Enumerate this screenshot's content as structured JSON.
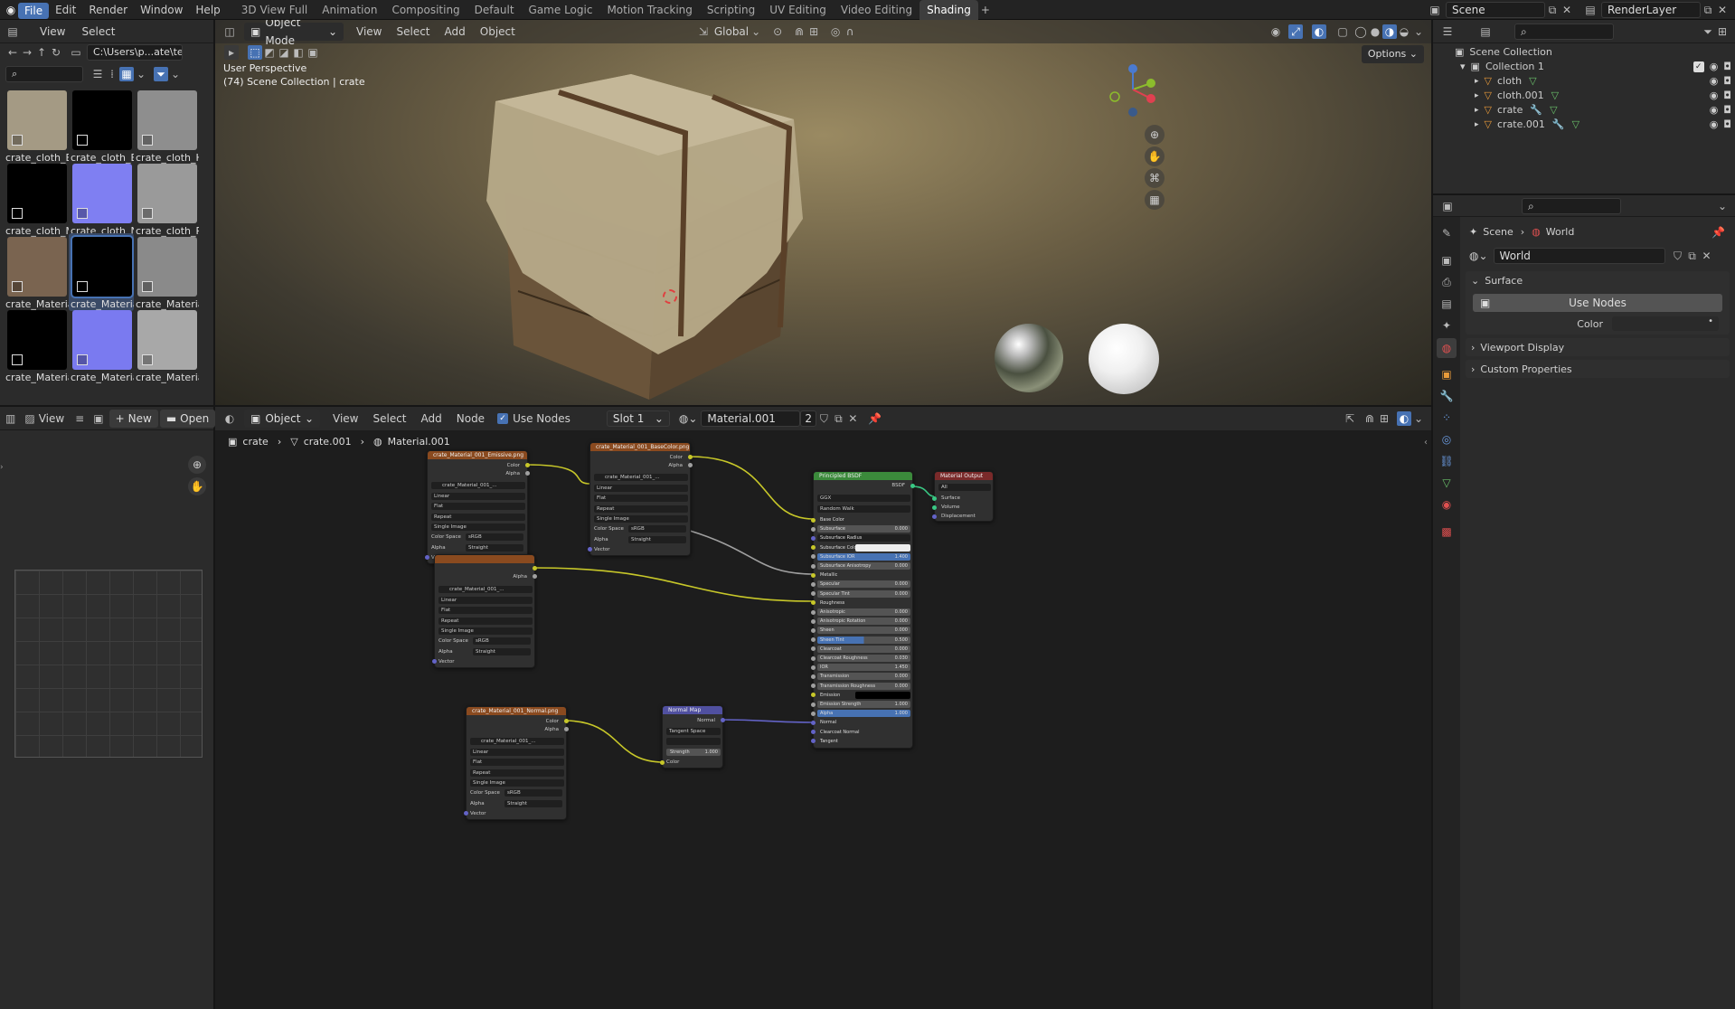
{
  "menu": [
    "File",
    "Edit",
    "Render",
    "Window",
    "Help"
  ],
  "workspaces": [
    "3D View Full",
    "Animation",
    "Compositing",
    "Default",
    "Game Logic",
    "Motion Tracking",
    "Scripting",
    "UV Editing",
    "Video Editing",
    "Shading"
  ],
  "scene_name": "Scene",
  "render_layer": "RenderLayer",
  "file_browser": {
    "menu": [
      "View",
      "Select"
    ],
    "path": "C:\\Users\\p...ate\\texture\\",
    "files": [
      {
        "label": "crate_cloth_B...",
        "color": "#a49a84"
      },
      {
        "label": "crate_cloth_E...",
        "color": "#000000"
      },
      {
        "label": "crate_cloth_H...",
        "color": "#8e8e8e"
      },
      {
        "label": "crate_cloth_M",
        "color": "#000000"
      },
      {
        "label": "crate_cloth_N...",
        "color": "#7f7ff2"
      },
      {
        "label": "crate_cloth_R...",
        "color": "#9a9a9a"
      },
      {
        "label": "crate_Materia...",
        "color": "#7a6450"
      },
      {
        "label": "crate_Materia...",
        "color": "#000000"
      },
      {
        "label": "crate_Materia...",
        "color": "#8a8a8a"
      },
      {
        "label": "crate_Materia...",
        "color": "#000000"
      },
      {
        "label": "crate_Materia...",
        "color": "#7a7af0"
      },
      {
        "label": "crate_Materia...",
        "color": "#a8a8a8"
      }
    ]
  },
  "viewport": {
    "mode": "Object Mode",
    "menu": [
      "View",
      "Select",
      "Add",
      "Object"
    ],
    "orientation": "Global",
    "perspective": "User Perspective",
    "context": "(74) Scene Collection | crate",
    "options": "Options"
  },
  "outliner": {
    "root": "Scene Collection",
    "collection": "Collection 1",
    "objects": [
      "cloth",
      "cloth.001",
      "crate",
      "crate.001"
    ]
  },
  "properties": {
    "crumb_scene": "Scene",
    "crumb_world": "World",
    "world_name": "World",
    "surface": "Surface",
    "use_nodes": "Use Nodes",
    "color_label": "Color",
    "viewport_display": "Viewport Display",
    "custom_properties": "Custom Properties"
  },
  "image_editor": {
    "view": "View",
    "new": "New",
    "open": "Open"
  },
  "node_editor": {
    "mode": "Object",
    "menu": [
      "View",
      "Select",
      "Add",
      "Node"
    ],
    "use_nodes": "Use Nodes",
    "slot": "Slot 1",
    "material": "Material.001",
    "users": "2",
    "breadcrumb": [
      "crate",
      "crate.001",
      "Material.001"
    ]
  },
  "nodes": {
    "emission": {
      "title": "crate_Material_001_Emissive.png",
      "image": "crate_Material_001_..."
    },
    "basecolor": {
      "title": "crate_Material_001_BaseColor.png",
      "image": "crate_Material_001_..."
    },
    "mid": {
      "title": "",
      "image": "crate_Material_001_..."
    },
    "normal_img": {
      "title": "crate_Material_001_Normal.png",
      "image": "crate_Material_001_..."
    },
    "tex_rows": [
      "Linear",
      "Flat",
      "Repeat",
      "Single Image"
    ],
    "colorspace_label": "Color Space",
    "colorspace": "sRGB",
    "alpha_label": "Alpha",
    "alpha": "Straight",
    "vector": "Vector",
    "color": "Color",
    "alpha_out": "Alpha",
    "normalmap": {
      "title": "Normal Map",
      "out": "Normal",
      "space": "Tangent Space",
      "strength_label": "Strength",
      "strength": "1.000",
      "color": "Color"
    },
    "bsdf": {
      "title": "Principled BSDF",
      "out": "BSDF",
      "dist": "GGX",
      "sss": "Random Walk",
      "inputs": [
        {
          "n": "Base Color",
          "v": "",
          "t": "label"
        },
        {
          "n": "Subsurface",
          "v": "0.000",
          "t": "slider"
        },
        {
          "n": "Subsurface Radius",
          "v": "",
          "t": "dd"
        },
        {
          "n": "Subsurface Color",
          "v": "",
          "t": "color"
        },
        {
          "n": "Subsurface IOR",
          "v": "1.400",
          "t": "blue"
        },
        {
          "n": "Subsurface Anisotropy",
          "v": "0.000",
          "t": "slider"
        },
        {
          "n": "Metallic",
          "v": "",
          "t": "label"
        },
        {
          "n": "Specular",
          "v": "0.000",
          "t": "slider"
        },
        {
          "n": "Specular Tint",
          "v": "0.000",
          "t": "slider"
        },
        {
          "n": "Roughness",
          "v": "",
          "t": "label"
        },
        {
          "n": "Anisotropic",
          "v": "0.000",
          "t": "slider"
        },
        {
          "n": "Anisotropic Rotation",
          "v": "0.000",
          "t": "slider"
        },
        {
          "n": "Sheen",
          "v": "0.000",
          "t": "slider"
        },
        {
          "n": "Sheen Tint",
          "v": "0.500",
          "t": "half"
        },
        {
          "n": "Clearcoat",
          "v": "0.000",
          "t": "slider"
        },
        {
          "n": "Clearcoat Roughness",
          "v": "0.030",
          "t": "slider"
        },
        {
          "n": "IOR",
          "v": "1.450",
          "t": "slider"
        },
        {
          "n": "Transmission",
          "v": "0.000",
          "t": "slider"
        },
        {
          "n": "Transmission Roughness",
          "v": "0.000",
          "t": "slider"
        },
        {
          "n": "Emission",
          "v": "",
          "t": "black"
        },
        {
          "n": "Emission Strength",
          "v": "1.000",
          "t": "slider"
        },
        {
          "n": "Alpha",
          "v": "1.000",
          "t": "blue"
        },
        {
          "n": "Normal",
          "v": "",
          "t": "label"
        },
        {
          "n": "Clearcoat Normal",
          "v": "",
          "t": "label"
        },
        {
          "n": "Tangent",
          "v": "",
          "t": "label"
        }
      ]
    },
    "output": {
      "title": "Material Output",
      "target": "All",
      "sockets": [
        "Surface",
        "Volume",
        "Displacement"
      ]
    }
  },
  "colors": {
    "accent": "#4772b3",
    "tex_header": "#8a4a1f",
    "shader_header": "#3b8a3b",
    "vector_header": "#5050a0",
    "output_header": "#7a2a2a"
  }
}
